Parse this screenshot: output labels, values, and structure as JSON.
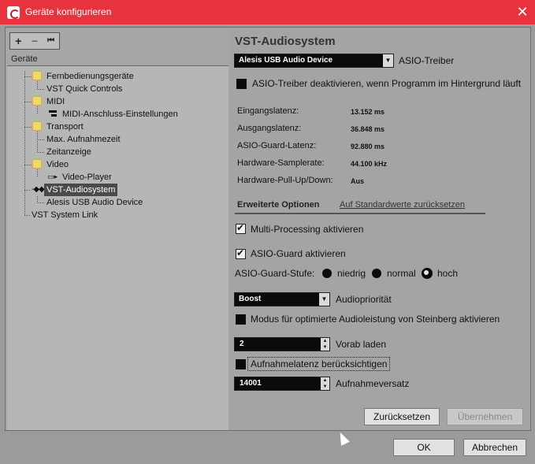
{
  "window": {
    "title": "Geräte konfigurieren"
  },
  "toolbar": {
    "add": "+",
    "remove": "−",
    "reset": "⏮"
  },
  "tree": {
    "header": "Geräte",
    "items": [
      "Fernbedienungsgeräte",
      "VST Quick Controls",
      "MIDI",
      "MIDI-Anschluss-Einstellungen",
      "Transport",
      "Max. Aufnahmezeit",
      "Zeitanzeige",
      "Video",
      "Video-Player",
      "VST-Audiosystem",
      "Alesis USB Audio Device",
      "VST System Link"
    ],
    "selected": "VST-Audiosystem"
  },
  "panel": {
    "title": "VST-Audiosystem",
    "driver_value": "Alesis USB Audio Device",
    "driver_label": "ASIO-Treiber",
    "deactivate_label": "ASIO-Treiber deaktivieren, wenn Programm im Hintergrund läuft",
    "info": [
      {
        "label": "Eingangslatenz:",
        "value": "13.152 ms"
      },
      {
        "label": "Ausgangslatenz:",
        "value": "36.848 ms"
      },
      {
        "label": "ASIO-Guard-Latenz:",
        "value": "92.880 ms"
      },
      {
        "label": "Hardware-Samplerate:",
        "value": "44.100 kHz"
      },
      {
        "label": "Hardware-Pull-Up/Down:",
        "value": "Aus"
      }
    ],
    "tab_advanced": "Erweiterte Optionen",
    "tab_defaults": "Auf Standardwerte zurücksetzen",
    "multiprocessing_label": "Multi-Processing aktivieren",
    "asioguard_label": "ASIO-Guard aktivieren",
    "asioguard_level_label": "ASIO-Guard-Stufe:",
    "level_low": "niedrig",
    "level_normal": "normal",
    "level_high": "hoch",
    "priority_value": "Boost",
    "priority_label": "Audiopriorität",
    "steinberg_label": "Modus für optimierte Audioleistung von Steinberg aktivieren",
    "preload_value": "2",
    "preload_label": "Vorab laden",
    "latency_label": "Aufnahmelatenz berücksichtigen",
    "offset_value": "14001",
    "offset_label": "Aufnahmeversatz",
    "reset_button": "Zurücksetzen",
    "apply_button": "Übernehmen"
  },
  "footer": {
    "ok_button": "OK",
    "cancel_button": "Abbrechen"
  }
}
